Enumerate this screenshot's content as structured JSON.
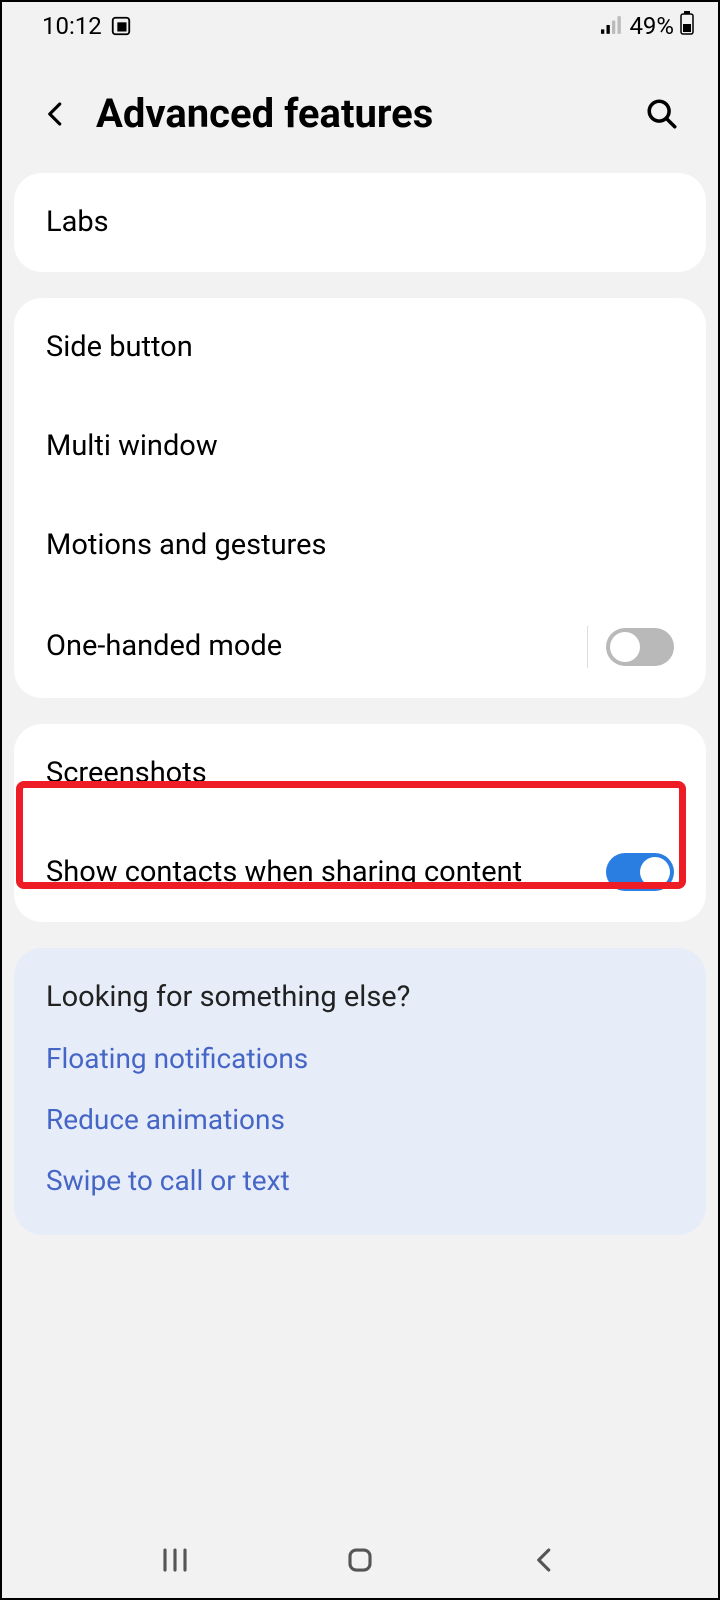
{
  "status_bar": {
    "time": "10:12",
    "battery": "49%"
  },
  "header": {
    "title": "Advanced features"
  },
  "groups": [
    {
      "rows": [
        {
          "label": "Labs"
        }
      ]
    },
    {
      "rows": [
        {
          "label": "Side button"
        },
        {
          "label": "Multi window"
        },
        {
          "label": "Motions and gestures"
        },
        {
          "label": "One-handed mode",
          "toggle": false,
          "divider": true
        }
      ]
    },
    {
      "rows": [
        {
          "label": "Screenshots",
          "highlighted": true
        },
        {
          "label": "Show contacts when sharing content",
          "toggle": true
        }
      ]
    }
  ],
  "suggestions": {
    "title": "Looking for something else?",
    "links": [
      "Floating notifications",
      "Reduce animations",
      "Swipe to call or text"
    ]
  },
  "colors": {
    "accent_blue": "#2a7de1",
    "link_blue": "#4666c7",
    "highlight_red": "#ee1c25"
  }
}
